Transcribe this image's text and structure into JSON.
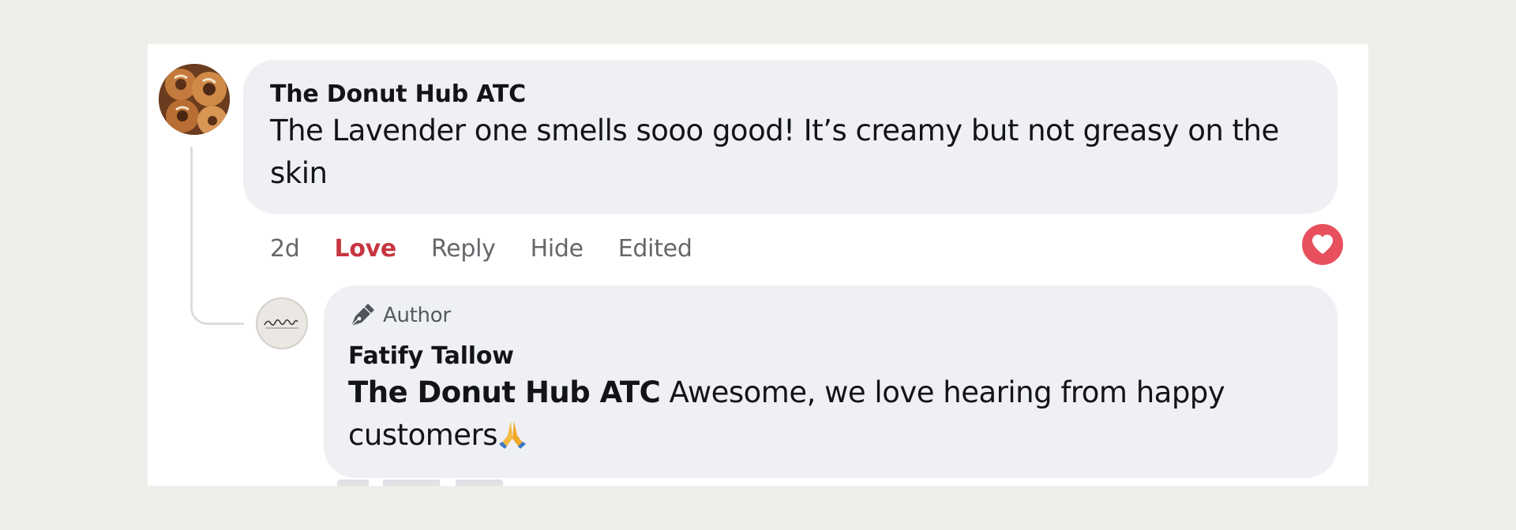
{
  "comment": {
    "author": "The Donut Hub ATC",
    "text": "The Lavender one smells sooo good! It’s creamy but not greasy on the skin",
    "actions": {
      "time": "2d",
      "reaction": "Love",
      "reply": "Reply",
      "hide": "Hide",
      "edited": "Edited"
    },
    "reaction_badge_icon": "heart-icon",
    "reaction_color": "#e8505e"
  },
  "reply": {
    "badge_icon": "pen-icon",
    "badge_label": "Author",
    "author": "Fatify Tallow",
    "mention": "The Donut Hub ATC",
    "text": "Awesome, we love hearing from happy customers",
    "emoji_icon": "folded-hands-emoji"
  },
  "colors": {
    "love_label": "#c73640",
    "bubble_bg": "#eff0f4",
    "page_bg": "#f0eeea"
  }
}
